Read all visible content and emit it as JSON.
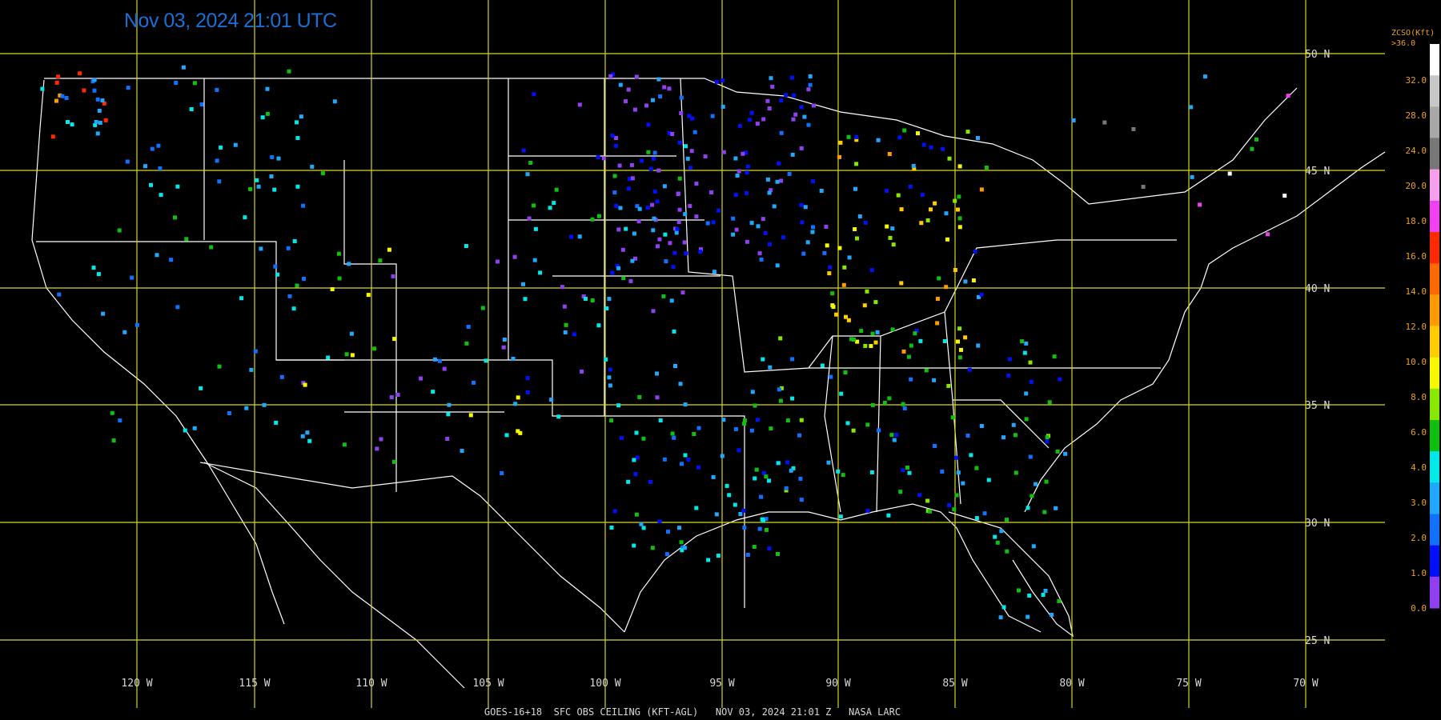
{
  "timestamp": "Nov 03, 2024 21:01 UTC",
  "footer": "GOES-16+18  SFC OBS CEILING (KFT-AGL)   NOV 03, 2024 21:01 Z   NASA LARC",
  "legend": {
    "title_line1": "ZCSO(Kft)",
    "title_line2": ">36.0",
    "labels": [
      "32.0",
      "28.0",
      "24.0",
      "20.0",
      "18.0",
      "16.0",
      "14.0",
      "12.0",
      "10.0",
      "8.0",
      "6.0",
      "4.0",
      "3.0",
      "2.0",
      "1.0",
      "0.0"
    ],
    "colors": [
      "#ffffff",
      "#c8c8c8",
      "#a8a8a8",
      "#787878",
      "#f8a0f0",
      "#f040f0",
      "#ff2a00",
      "#ff6a00",
      "#ff9a00",
      "#ffcc00",
      "#f8f800",
      "#88e800",
      "#10c010",
      "#00e8e8",
      "#20a8ff",
      "#1070ff",
      "#0010f8",
      "#9040f0"
    ]
  },
  "lat_labels": [
    "50 N",
    "45 N",
    "40 N",
    "35 N",
    "30 N",
    "25 N"
  ],
  "lon_labels": [
    "120 W",
    "115 W",
    "110 W",
    "105 W",
    "100 W",
    "95 W",
    "90 W",
    "85 W",
    "80 W",
    "75 W",
    "70 W"
  ],
  "grid_color": "#d8d820",
  "border_color": "#ffffff",
  "station_colors": {
    "purple": "#9040f0",
    "blue": "#0010f8",
    "lblue": "#1070ff",
    "sky": "#20a8ff",
    "cyan": "#00e8e8",
    "green": "#10c010",
    "lgreen": "#88e800",
    "yellow": "#f8f800",
    "gold": "#ffcc00",
    "orange": "#ff9a00",
    "red": "#ff2a00",
    "magenta": "#f040f0",
    "gray": "#787878",
    "white": "#ffffff"
  }
}
